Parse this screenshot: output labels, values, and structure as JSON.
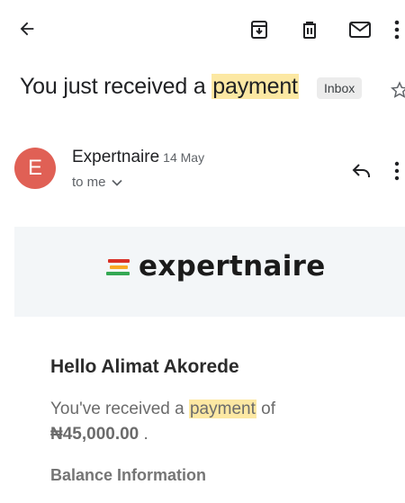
{
  "toolbar": {
    "back_icon": "arrow-left-icon",
    "archive_icon": "archive-icon",
    "delete_icon": "trash-icon",
    "unread_icon": "mail-icon",
    "more_icon": "more-vert-icon"
  },
  "subject": {
    "prefix": "You just received a ",
    "highlight": "payment",
    "label": "Inbox"
  },
  "sender": {
    "avatar_letter": "E",
    "avatar_color": "#e06055",
    "name": "Expertnaire",
    "date": "14 May",
    "recipient": "to me"
  },
  "email_body": {
    "brand_name": "expertnaire",
    "brand_colors": [
      "#d93025",
      "#f9a825",
      "#34a853"
    ],
    "greeting": "Hello Alimat Akorede",
    "message_prefix": "You've received a ",
    "message_highlight": "payment",
    "message_suffix": " of",
    "amount": "₦45,000.00",
    "amount_suffix": " .",
    "section_heading": "Balance Information"
  },
  "colors": {
    "highlight": "#fce8a3",
    "banner_bg": "#f3f6f8"
  }
}
